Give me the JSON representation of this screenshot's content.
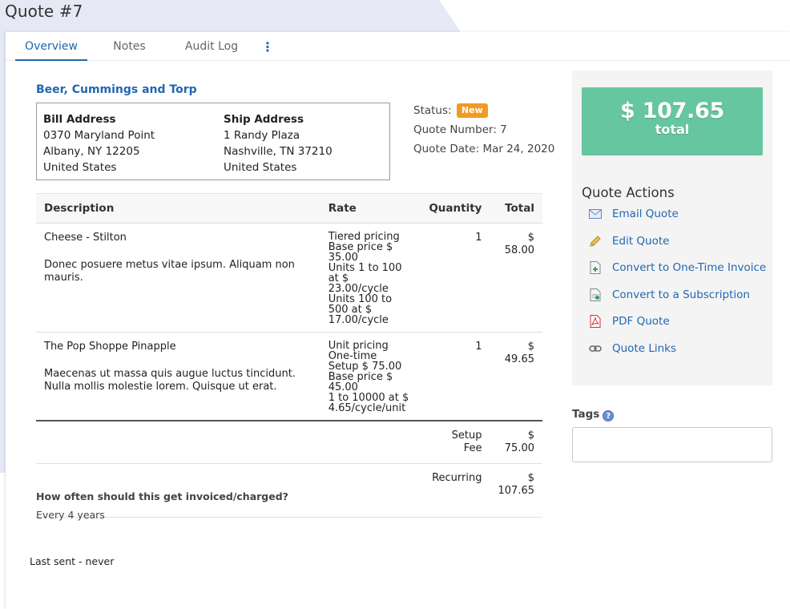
{
  "page": {
    "title": "Quote #7"
  },
  "tabs": [
    {
      "label": "Overview"
    },
    {
      "label": "Notes"
    },
    {
      "label": "Audit Log"
    },
    {
      "label": "⋮"
    }
  ],
  "customer": {
    "name": "Beer, Cummings and Torp"
  },
  "bill_address": {
    "heading": "Bill Address",
    "line1": "0370 Maryland Point",
    "line2": "Albany, NY 12205",
    "line3": "United States"
  },
  "ship_address": {
    "heading": "Ship Address",
    "line1": "1 Randy Plaza",
    "line2": "Nashville, TN 37210",
    "line3": "United States"
  },
  "meta": {
    "status_label": "Status:",
    "status_value": "New",
    "number_label": "Quote Number:",
    "number_value": "7",
    "date_label": "Quote Date:",
    "date_value": "Mar 24, 2020"
  },
  "table": {
    "headers": {
      "description": "Description",
      "rate": "Rate",
      "quantity": "Quantity",
      "total": "Total"
    },
    "rows": [
      {
        "name": "Cheese - Stilton",
        "description": "Donec posuere metus vitae ipsum. Aliquam non mauris.",
        "rate": [
          "Tiered pricing",
          "Base price $ 35.00",
          "Units 1 to 100 at $ 23.00/cycle",
          "Units 100 to 500 at $ 17.00/cycle"
        ],
        "quantity": "1",
        "total": "$ 58.00"
      },
      {
        "name": "The Pop Shoppe Pinapple",
        "description": "Maecenas ut massa quis augue luctus tincidunt. Nulla mollis molestie lorem. Quisque ut erat.",
        "rate": [
          "Unit pricing",
          "One-time Setup $ 75.00",
          "Base price $ 45.00",
          "1 to 10000 at $ 4.65/cycle/unit"
        ],
        "quantity": "1",
        "total": "$ 49.65"
      }
    ],
    "summary": [
      {
        "label": "Setup Fee",
        "value": "$ 75.00"
      },
      {
        "label": "Recurring",
        "value": "$ 107.65"
      }
    ]
  },
  "billing": {
    "question": "How often should this get invoiced/charged?",
    "answer": "Every 4 years"
  },
  "last_sent": "Last sent - never",
  "total": {
    "amount": "$ 107.65",
    "label": "total"
  },
  "actions": {
    "title": "Quote Actions",
    "items": [
      {
        "label": "Email Quote",
        "icon": "envelope-icon"
      },
      {
        "label": "Edit Quote",
        "icon": "pencil-icon"
      },
      {
        "label": "Convert to One-Time Invoice",
        "icon": "document-add-icon"
      },
      {
        "label": "Convert to a Subscription",
        "icon": "document-recurring-icon"
      },
      {
        "label": "PDF Quote",
        "icon": "pdf-icon"
      },
      {
        "label": "Quote Links",
        "icon": "link-icon"
      }
    ]
  },
  "tags": {
    "label": "Tags",
    "help": "?",
    "value": ""
  },
  "colors": {
    "accent": "#2167b2",
    "total_box": "#66c6a0",
    "status_badge": "#f29a23",
    "header_shape": "#e6e9f5"
  }
}
